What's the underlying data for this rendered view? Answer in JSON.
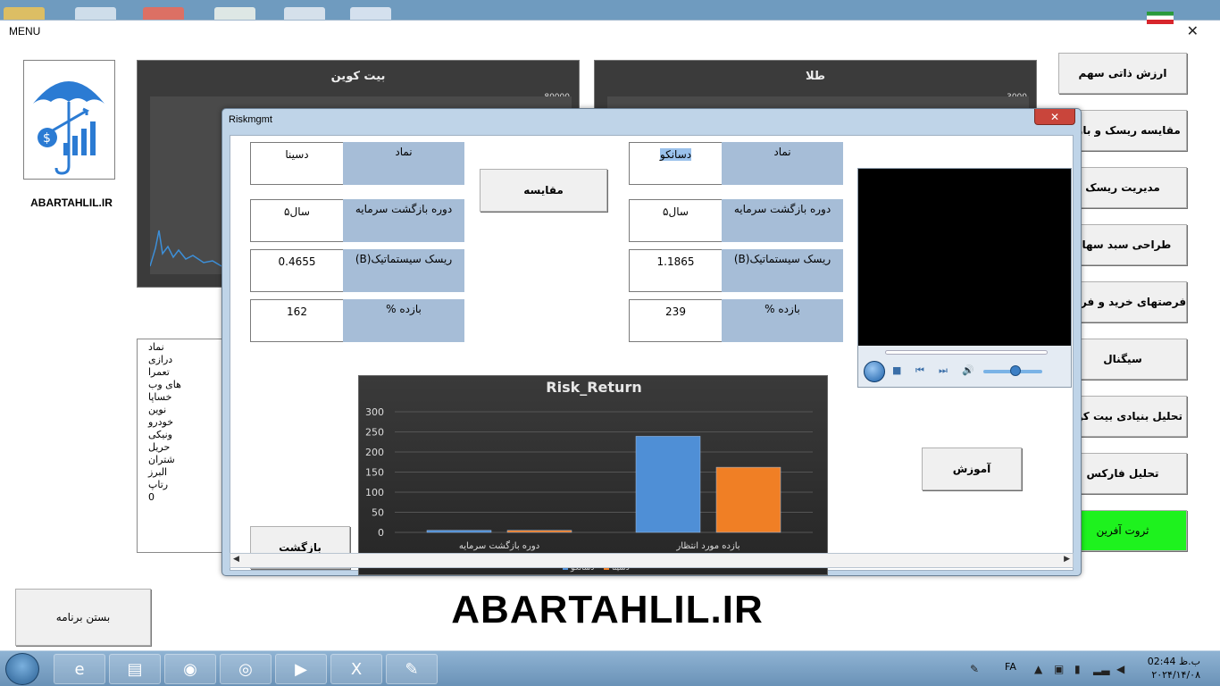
{
  "app": {
    "menu_label": "MENU",
    "close_glyph": "✕",
    "brand_caption": "ABARTAHLIL.IR",
    "big_brand": "ABARTAHLIL.IR"
  },
  "panels": {
    "bitcoin": {
      "title": "بیت کوین",
      "tick": "80000"
    },
    "gold": {
      "title": "طلا",
      "tick": "3000"
    }
  },
  "list": [
    "نماد",
    "درازی",
    "تعمرا",
    "های وب",
    "خساپا",
    "نوین",
    "خودرو",
    "ونیکی",
    "حریل",
    "شتران",
    "البرز",
    "رتاپ",
    "0"
  ],
  "close_app_label": "بستن برنامه",
  "menu_buttons": [
    {
      "label": "ارزش ذاتی سهم"
    },
    {
      "label": "مقایسه ریسک و بازده"
    },
    {
      "label": "مدیریت ریسک"
    },
    {
      "label": "طراحی سبد سهام"
    },
    {
      "label": "فرصتهای خرید و فروش"
    },
    {
      "label": "سیگنال"
    },
    {
      "label": "تحلیل بنیادی بیت کوین"
    },
    {
      "label": "تحلیل فارکس"
    },
    {
      "label": "ثروت آفرین"
    }
  ],
  "dialog": {
    "title": "Riskmgmt",
    "close_glyph": "✕",
    "compare_label": "مقایسه",
    "back_label": "بازگشت",
    "learn_label": "آموزش",
    "left": {
      "symbol_label": "نماد",
      "symbol_value": "دسینا",
      "payback_label": "دوره بازگشت سرمایه",
      "payback_value": "۵سال",
      "risk_label": "ریسک سیستماتیک(B)",
      "risk_value": "0.4655",
      "return_label": "بازده %",
      "return_value": "162"
    },
    "right": {
      "symbol_label": "نماد",
      "symbol_value": "دسانکو",
      "payback_label": "دوره بازگشت سرمایه",
      "payback_value": "۵سال",
      "risk_label": "ریسک سیستماتیک(B)",
      "risk_value": "1.1865",
      "return_label": "بازده %",
      "return_value": "239"
    }
  },
  "chart_data": {
    "type": "bar",
    "title": "Risk_Return",
    "categories": [
      "دوره بازگشت سرمایه",
      "بازده مورد انتظار"
    ],
    "series": [
      {
        "name": "دسانکو",
        "values": [
          5,
          239
        ],
        "color": "#4f8fd6"
      },
      {
        "name": "دسینا",
        "values": [
          5,
          162
        ],
        "color": "#f07f25"
      }
    ],
    "yticks": [
      "0",
      "50",
      "100",
      "150",
      "200",
      "250",
      "300"
    ],
    "ylim": [
      0,
      300
    ],
    "legend": "bottom",
    "grid": true
  },
  "taskbar": {
    "lang": "FA",
    "time": "02:44 ب.ظ",
    "date": "۲۰۲۴/۱۴/۰۸",
    "apps": [
      "ie-icon",
      "folder-icon",
      "firefox-icon",
      "chrome-icon",
      "media-icon",
      "excel-icon",
      "paint-icon"
    ]
  },
  "colors": {
    "accent_green": "#1ef21e",
    "label_blue": "#a6bdd7",
    "bar_blue": "#4f8fd6",
    "bar_orange": "#f07f25"
  }
}
